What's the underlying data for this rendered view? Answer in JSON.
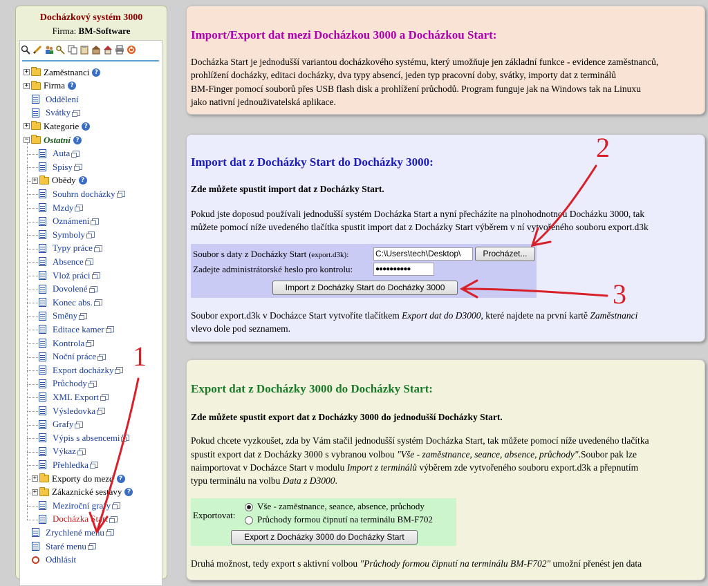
{
  "sidebar": {
    "title": "Docházkový systém 3000",
    "company_label": "Firma:",
    "company_name": "BM-Software",
    "toolbar_icons": [
      "search-icon",
      "pencil-icon",
      "users-icon",
      "key-icon",
      "copy-icon",
      "clipboard-icon",
      "building-icon",
      "house-icon",
      "printer-icon",
      "power-icon"
    ],
    "items": [
      {
        "label": "Zaměstnanci",
        "type": "folder"
      },
      {
        "label": "Firma",
        "type": "folder"
      },
      {
        "label": "Oddělení",
        "type": "page"
      },
      {
        "label": "Svátky",
        "type": "page"
      },
      {
        "label": "Kategorie",
        "type": "folder"
      },
      {
        "label": "Ostatní",
        "type": "folder-open"
      },
      {
        "label": "Auta",
        "type": "page"
      },
      {
        "label": "Spisy",
        "type": "page"
      },
      {
        "label": "Obědy",
        "type": "folder"
      },
      {
        "label": "Souhrn docházky",
        "type": "page"
      },
      {
        "label": "Mzdy",
        "type": "page"
      },
      {
        "label": "Oznámení",
        "type": "page"
      },
      {
        "label": "Symboly",
        "type": "page"
      },
      {
        "label": "Typy práce",
        "type": "page"
      },
      {
        "label": "Absence",
        "type": "page"
      },
      {
        "label": "Vlož práci",
        "type": "page"
      },
      {
        "label": "Dovolené",
        "type": "page"
      },
      {
        "label": "Konec abs.",
        "type": "page"
      },
      {
        "label": "Směny",
        "type": "page"
      },
      {
        "label": "Editace kamer",
        "type": "page"
      },
      {
        "label": "Kontrola",
        "type": "page"
      },
      {
        "label": "Noční práce",
        "type": "page"
      },
      {
        "label": "Export docházky",
        "type": "page"
      },
      {
        "label": "Průchody",
        "type": "page"
      },
      {
        "label": "XML Export",
        "type": "page"
      },
      {
        "label": "Výsledovka",
        "type": "page"
      },
      {
        "label": "Grafy",
        "type": "page"
      },
      {
        "label": "Výpis s absencemi",
        "type": "page"
      },
      {
        "label": "Výkaz",
        "type": "page"
      },
      {
        "label": "Přehledka",
        "type": "page"
      },
      {
        "label": "Exporty do mezd",
        "type": "folder"
      },
      {
        "label": "Zákaznické sestavy",
        "type": "folder"
      },
      {
        "label": "Meziroční grafy",
        "type": "page"
      },
      {
        "label": "Docházka Start",
        "type": "page"
      },
      {
        "label": "Zrychlené menu",
        "type": "page"
      },
      {
        "label": "Staré menu",
        "type": "page"
      },
      {
        "label": "Odhlásit",
        "type": "logout"
      }
    ]
  },
  "panel1": {
    "title": "Import/Export dat mezi Docházkou 3000 a Docházkou Start:",
    "lines": [
      "Docházka Start je jednodušší variantou docházkového systému, který umožňuje jen základní funkce - evidence zaměstnanců,",
      "prohlížení docházky, editaci docházky, dva typy absencí, jeden typ pracovní doby, svátky, importy dat z terminálů",
      "BM-Finger pomocí souborů přes USB flash disk a prohlížení průchodů. Program funguje jak na Windows tak na Linuxu",
      "jako nativní jednouživatelská aplikace."
    ],
    "title_color": "#b000b0"
  },
  "panel2": {
    "title": "Import dat z Docházky Start do Docházky 3000:",
    "subtitle": "Zde můžete spustit import dat z Docházky Start.",
    "lines": [
      "Pokud jste doposud používali jednodušší systém Docházka Start a nyní přecházíte na plnohodnotnou Docházku 3000, tak",
      "můžete pomocí níže uvedeného tlačítka spustit import dat z Docházky Start výběrem v ní vytvořeného souboru export.d3k"
    ],
    "file_label": "Soubor s daty z Docházky Start",
    "file_hint": "(export.d3k):",
    "file_value": "C:\\Users\\tech\\Desktop\\",
    "browse_label": "Procházet...",
    "password_label": "Zadejte administrátorské heslo pro kontrolu:",
    "password_value": "●●●●●●●●●●",
    "import_button": "Import z Docházky Start do Docházky 3000",
    "note_prefix": "Soubor export.d3k v Docházce Start vytvoříte tlačítkem ",
    "note_em1": "Export dat do D3000",
    "note_mid": ", které najdete na první kartě ",
    "note_em2": "Zaměstnanci",
    "note_end": "vlevo dole pod seznamem.",
    "title_color": "#1a1ab8"
  },
  "panel3": {
    "title": "Export dat z Docházky 3000 do Docházky Start:",
    "subtitle": "Zde můžete spustit export dat z Docházky 3000 do jednodušší Docházky Start.",
    "line1": "Pokud chcete vyzkoušet, zda by Vám stačil jednodušší systém Docházka Start, tak můžete pomocí níže uvedeného tlačítka",
    "line2_prefix": "spustit export dat z Docházky 3000 s vybranou volbou ",
    "line2_em": "\"Vše - zaměstnance, seance, absence, průchody\"",
    "line2_suffix": ".Soubor pak lze",
    "line3_prefix": "naimportovat v Docházce Start v modulu ",
    "line3_em": "Import z terminálů",
    "line3_suffix": " výběrem zde vytvořeného souboru export.d3k a přepnutím",
    "line4_prefix": "typu terminálu na volbu ",
    "line4_em": "Data z D3000",
    "line4_suffix": ".",
    "export_label": "Exportovat:",
    "option1": "Vše - zaměstnance, seance, absence, průchody",
    "option2": "Průchody formou čipnutí na terminálu BM-F702",
    "export_button": "Export z Docházky 3000 do Docházky Start",
    "last_prefix": "Druhá možnost, tedy export s aktivní volbou ",
    "last_em": "\"Průchody formou čipnutí na terminálu BM-F702\"",
    "last_suffix": " umožní přenést jen data",
    "title_color": "#1a7a2a"
  },
  "annotations": [
    "1",
    "2",
    "3"
  ],
  "annotation_color": "#d8202a"
}
